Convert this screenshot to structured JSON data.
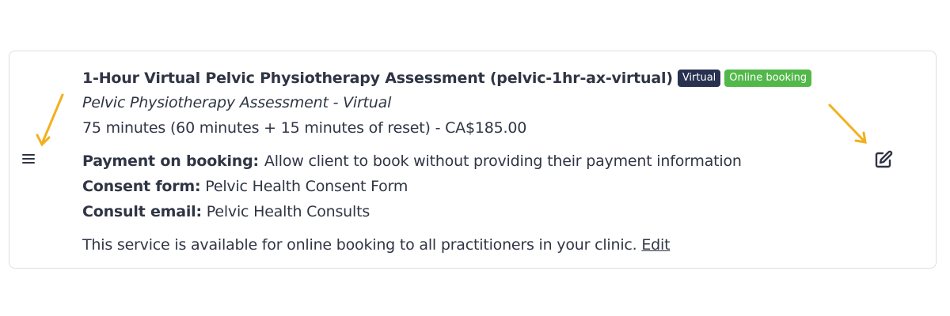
{
  "service": {
    "title": "1-Hour Virtual Pelvic Physiotherapy Assessment (pelvic-1hr-ax-virtual)",
    "badges": {
      "virtual": "Virtual",
      "online_booking": "Online booking"
    },
    "subtitle": "Pelvic Physiotherapy Assessment - Virtual",
    "duration": "75 minutes (60 minutes + 15 minutes of reset) - CA$185.00",
    "details": {
      "payment_label": "Payment on booking:",
      "payment_value": "Allow client to book without providing their payment information",
      "consent_label": "Consent form:",
      "consent_value": "Pelvic Health Consent Form",
      "consult_label": "Consult email:",
      "consult_value": "Pelvic Health Consults"
    },
    "availability": {
      "text": "This service is available for online booking to all practitioners in your clinic.",
      "edit_link": "Edit"
    }
  },
  "icons": {
    "drag_handle": "hamburger-menu-icon",
    "edit": "edit-square-pencil-icon"
  },
  "colors": {
    "text": "#2f3544",
    "badge_virtual": "#283250",
    "badge_online": "#52b84a",
    "annotation_arrow": "#f2b01e",
    "card_border": "#dcdfe4"
  }
}
